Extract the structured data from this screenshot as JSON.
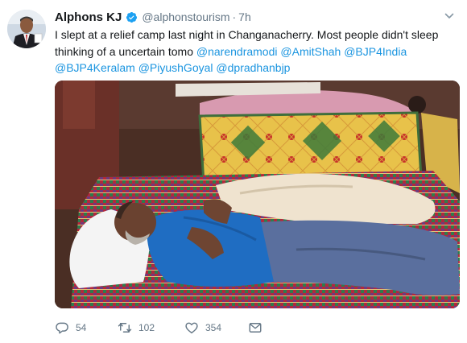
{
  "tweet": {
    "display_name": "Alphons KJ",
    "handle": "@alphonstourism",
    "separator": "·",
    "time": "7h",
    "text_plain": "I slept at a relief camp last night in Changanacherry. Most people didn't sleep thinking of a uncertain tomo",
    "mentions": [
      "@narendramodi",
      "@AmitShah",
      "@BJP4India",
      "@BJP4Keralam",
      "@PiyushGoyal",
      "@dpradhanbjp"
    ],
    "reply_count": "54",
    "retweet_count": "102",
    "like_count": "354"
  },
  "colors": {
    "link": "#1b95e0",
    "secondary_text": "#657786",
    "verified": "#1da1f2"
  },
  "icons": [
    "verified-badge-icon",
    "chevron-down-icon",
    "reply-icon",
    "retweet-icon",
    "like-icon",
    "direct-message-icon"
  ]
}
